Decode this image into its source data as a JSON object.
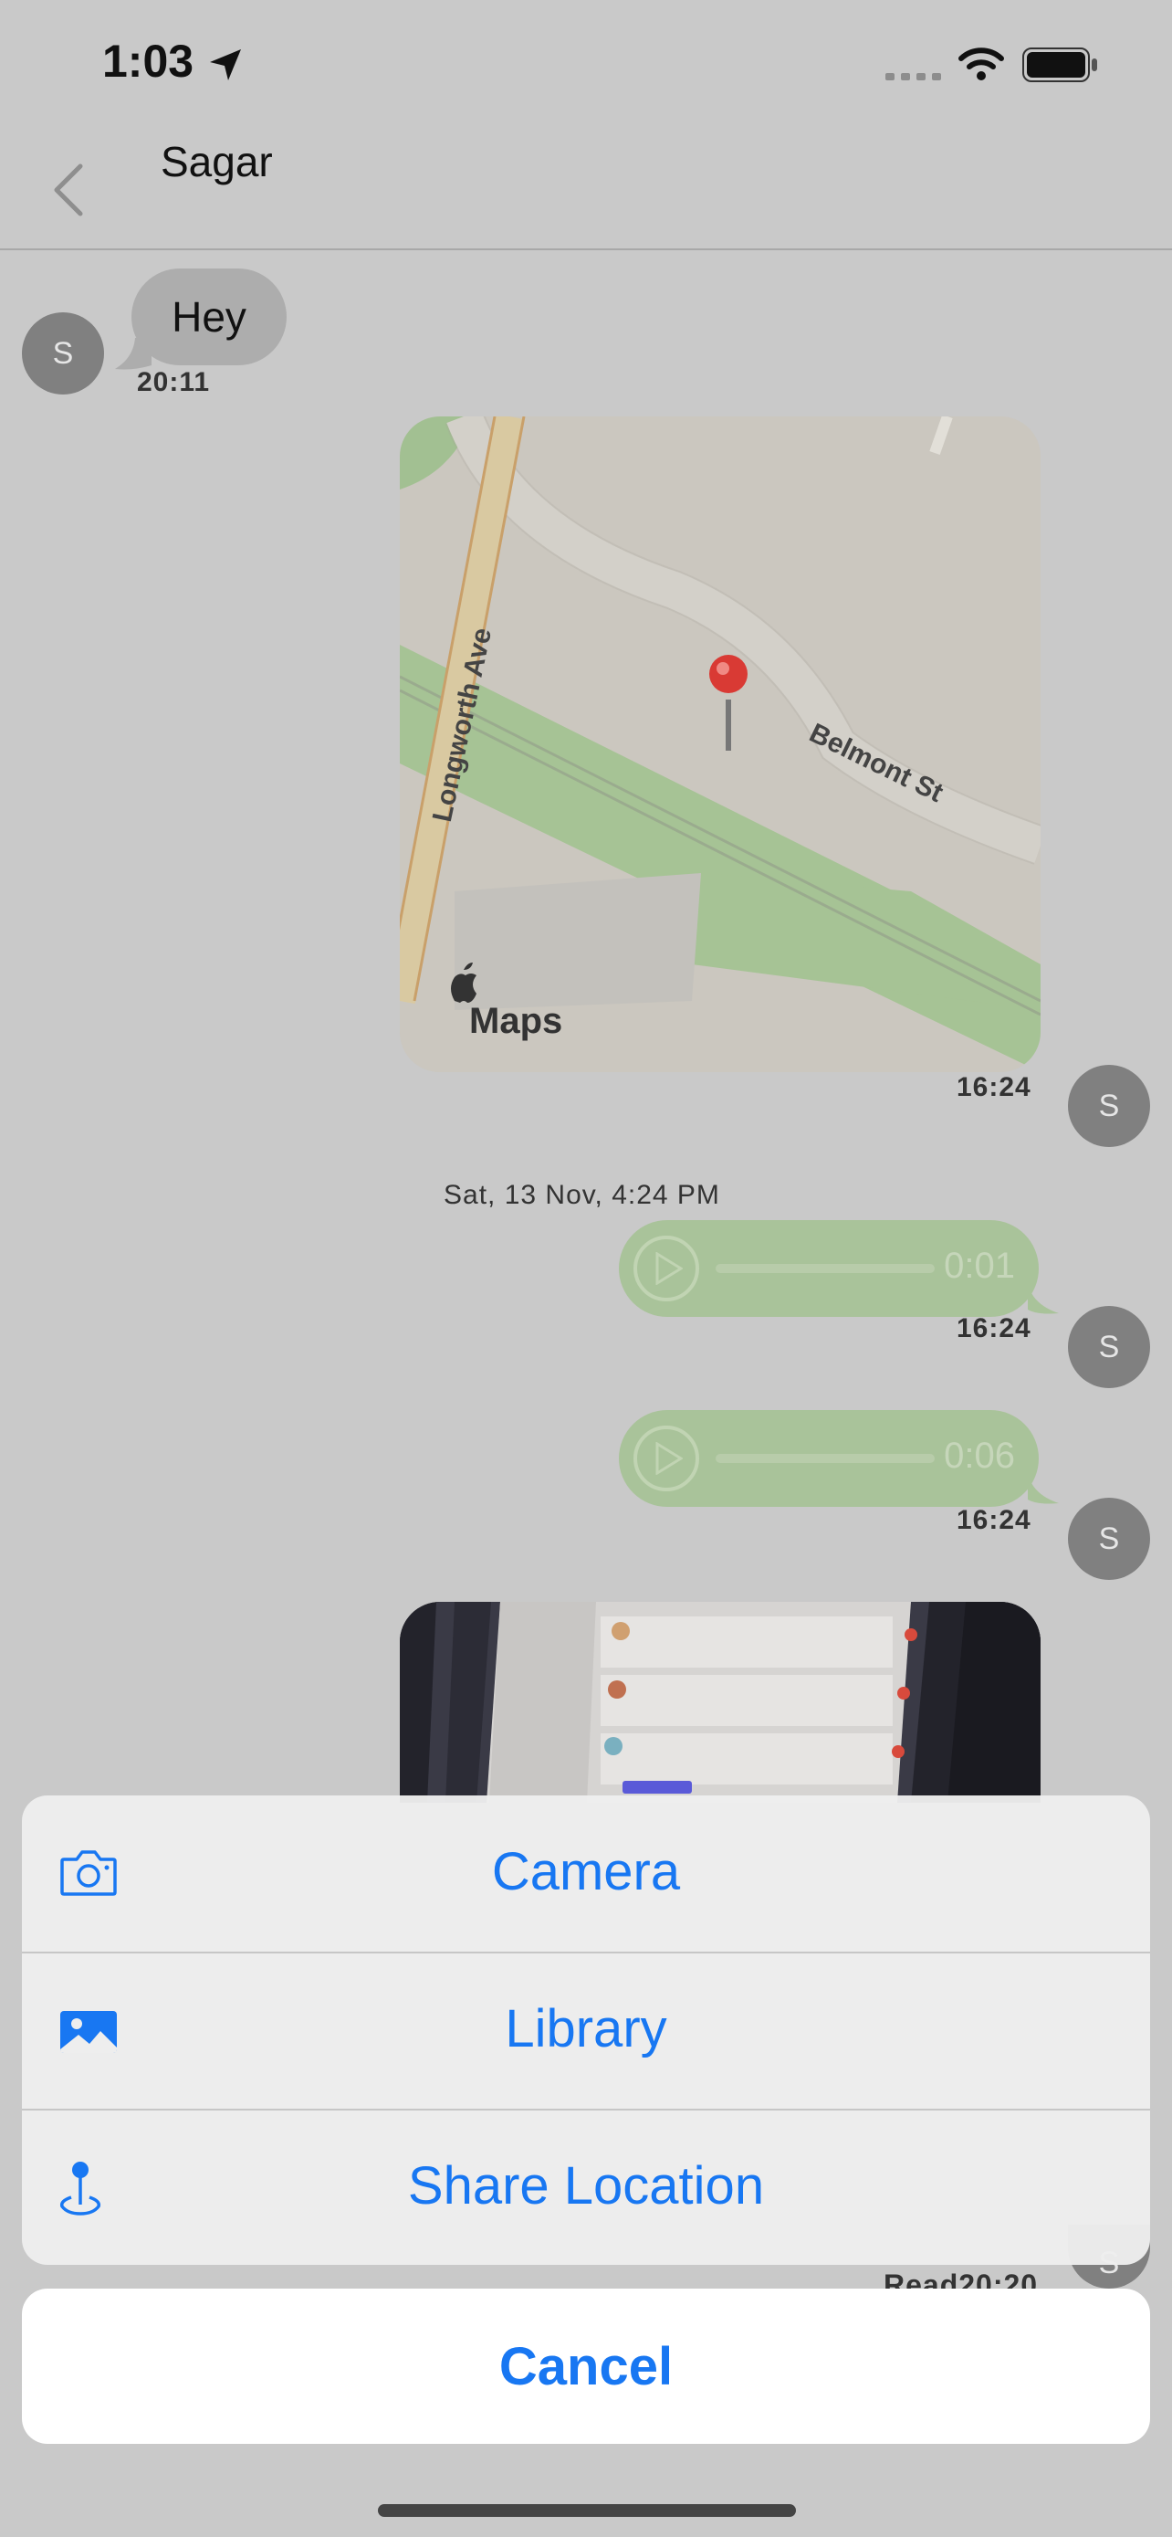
{
  "status_bar": {
    "time": "1:03"
  },
  "nav": {
    "title": "Sagar"
  },
  "messages": {
    "incoming_text": "Hey",
    "incoming_time": "20:11",
    "incoming_avatar": "S",
    "map_time": "16:24",
    "map_avatar": "S",
    "map_labels": {
      "street1": "Longworth Ave",
      "street2": "Belmont St",
      "brand": "Maps"
    },
    "date_separator": "Sat, 13 Nov, 4:24 PM",
    "voice1_duration": "0:01",
    "voice1_time": "16:24",
    "voice1_avatar": "S",
    "voice2_duration": "0:06",
    "voice2_time": "16:24",
    "voice2_avatar": "S",
    "last_status": "Read20:20",
    "last_avatar": "S"
  },
  "action_sheet": {
    "camera": "Camera",
    "library": "Library",
    "share_location": "Share Location",
    "cancel": "Cancel"
  },
  "colors": {
    "accent": "#1877f2",
    "voice_bubble": "#a9c39a",
    "avatar": "#808080"
  }
}
